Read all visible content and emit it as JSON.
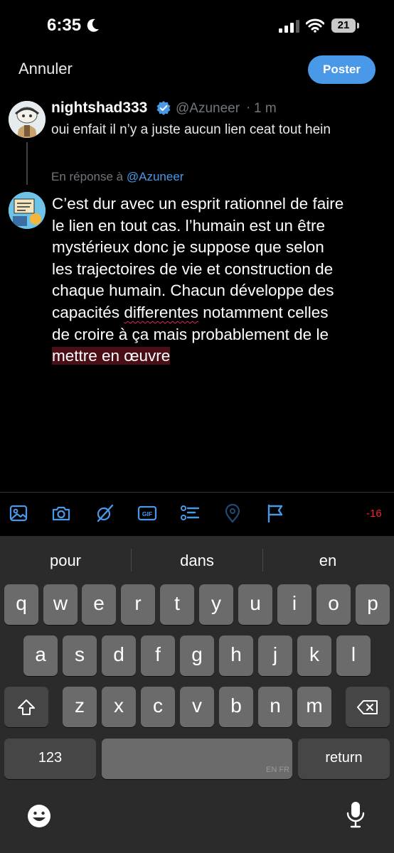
{
  "status_bar": {
    "time": "6:35",
    "battery": "21"
  },
  "header": {
    "cancel_label": "Annuler",
    "post_label": "Poster"
  },
  "parent_tweet": {
    "display_name": "nightshad333",
    "handle": "@Azuneer",
    "separator": "·",
    "time_ago": "1 m",
    "text": "oui enfait il n’y a juste aucun lien ceat tout hein"
  },
  "reply": {
    "prefix": "En réponse à",
    "handle": "@Azuneer"
  },
  "compose": {
    "lines": [
      "C’est dur avec un esprit rationnel de faire",
      "le lien en tout cas. l’humain est un être",
      "mystérieux donc je suppose que selon",
      "les trajectoires de vie et construction de",
      "chaque humain. Chacun développe des"
    ],
    "line6_before": "capacités ",
    "line6_misspelled": "differentes",
    "line6_after": " notamment celles",
    "line7": "de croire à ça mais probablement de le",
    "line8_over_limit": "mettre en œuvre "
  },
  "toolbar": {
    "icons": [
      "image-icon",
      "camera-icon",
      "grok-icon",
      "gif-icon",
      "poll-icon",
      "location-icon",
      "flag-icon"
    ],
    "gif_label": "GIF",
    "char_counter": "-16"
  },
  "keyboard": {
    "suggestions": [
      "pour",
      "dans",
      "en"
    ],
    "row1": [
      "q",
      "w",
      "e",
      "r",
      "t",
      "y",
      "u",
      "i",
      "o",
      "p"
    ],
    "row2": [
      "a",
      "s",
      "d",
      "f",
      "g",
      "h",
      "j",
      "k",
      "l"
    ],
    "row3": [
      "z",
      "x",
      "c",
      "v",
      "b",
      "n",
      "m"
    ],
    "numbers_label": "123",
    "return_label": "return",
    "space_languages": "EN FR"
  },
  "colors": {
    "accent": "#4a99e9",
    "error": "#f4212e",
    "background": "#000000",
    "keyboard_bg": "#2b2b2b"
  }
}
